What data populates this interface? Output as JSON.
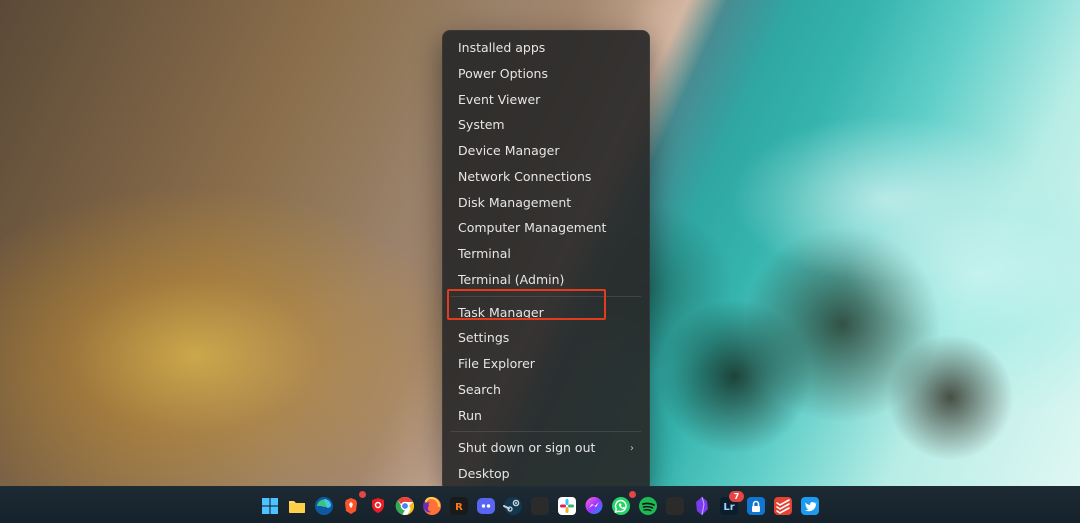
{
  "context_menu": {
    "groups": [
      [
        {
          "id": "installed-apps",
          "label": "Installed apps"
        },
        {
          "id": "power-options",
          "label": "Power Options"
        },
        {
          "id": "event-viewer",
          "label": "Event Viewer"
        },
        {
          "id": "system",
          "label": "System"
        },
        {
          "id": "device-manager",
          "label": "Device Manager"
        },
        {
          "id": "network-connections",
          "label": "Network Connections"
        },
        {
          "id": "disk-management",
          "label": "Disk Management"
        },
        {
          "id": "computer-management",
          "label": "Computer Management"
        },
        {
          "id": "terminal",
          "label": "Terminal"
        },
        {
          "id": "terminal-admin",
          "label": "Terminal (Admin)"
        }
      ],
      [
        {
          "id": "task-manager",
          "label": "Task Manager",
          "highlighted": true
        },
        {
          "id": "settings",
          "label": "Settings"
        },
        {
          "id": "file-explorer",
          "label": "File Explorer"
        },
        {
          "id": "search",
          "label": "Search"
        },
        {
          "id": "run",
          "label": "Run"
        }
      ],
      [
        {
          "id": "shut-down",
          "label": "Shut down or sign out",
          "submenu": true
        },
        {
          "id": "desktop",
          "label": "Desktop"
        }
      ]
    ]
  },
  "taskbar": {
    "items": [
      {
        "id": "start",
        "icon": "windows",
        "bg": "transparent"
      },
      {
        "id": "file-explorer",
        "icon": "folder",
        "bg": "#ffc84a"
      },
      {
        "id": "edge",
        "icon": "edge",
        "bg": "transparent"
      },
      {
        "id": "brave",
        "icon": "brave",
        "bg": "#fb542b",
        "letter": "B",
        "badge": ""
      },
      {
        "id": "authy",
        "icon": "shield",
        "bg": "#ec1c24"
      },
      {
        "id": "chrome",
        "icon": "chrome",
        "bg": "transparent"
      },
      {
        "id": "firefox",
        "icon": "firefox",
        "bg": "transparent"
      },
      {
        "id": "reddit",
        "icon": "R",
        "bg": "#1a1a1b",
        "letter": "R",
        "fg": "#ff7a18"
      },
      {
        "id": "discord",
        "icon": "discord",
        "bg": "#5865f2"
      },
      {
        "id": "steam",
        "icon": "steam",
        "bg": "#14364f"
      },
      {
        "id": "gamebar",
        "icon": "generic",
        "bg": "#2b2b2b"
      },
      {
        "id": "slack",
        "icon": "slack",
        "bg": "#ffffff"
      },
      {
        "id": "messenger",
        "icon": "messenger",
        "bg": "transparent"
      },
      {
        "id": "whatsapp",
        "icon": "whatsapp",
        "bg": "#25d366",
        "badge": ""
      },
      {
        "id": "spotify",
        "icon": "spotify",
        "bg": "#1db954"
      },
      {
        "id": "onedrive",
        "icon": "generic",
        "bg": "#2b2b2b"
      },
      {
        "id": "obsidian",
        "icon": "obsidian",
        "bg": "transparent"
      },
      {
        "id": "lightroom",
        "icon": "Lr",
        "bg": "#0a1e2e",
        "letter": "Lr",
        "fg": "#9fd3ff",
        "badge": "7"
      },
      {
        "id": "enpass",
        "icon": "lock",
        "bg": "#0f76d1"
      },
      {
        "id": "todoist",
        "icon": "todoist",
        "bg": "#e44332"
      },
      {
        "id": "twitter",
        "icon": "twitter",
        "bg": "#1d9bf0"
      }
    ]
  }
}
